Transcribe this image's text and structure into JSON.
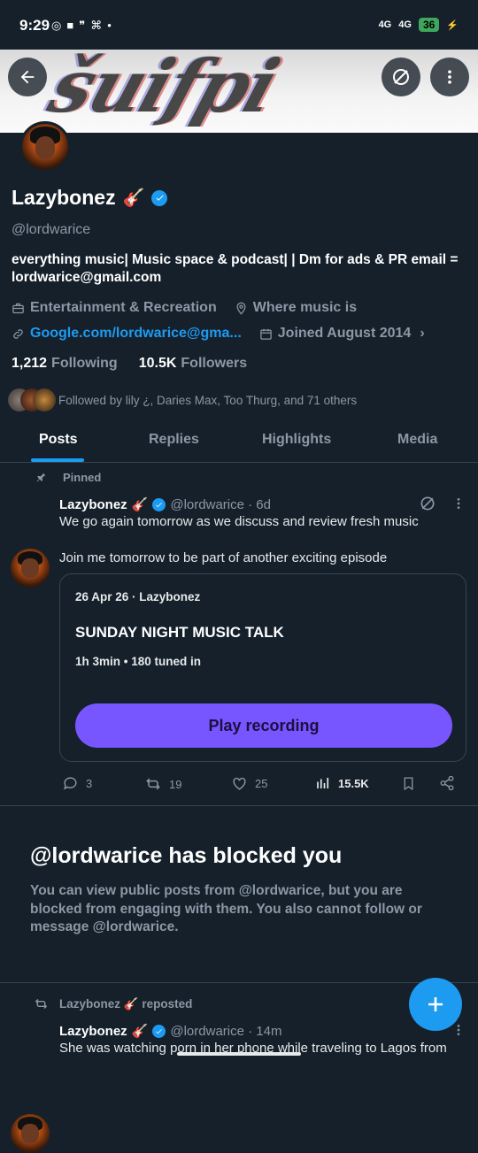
{
  "status_bar": {
    "time": "9:29",
    "signal1": "4G",
    "signal2": "4G",
    "battery": "36"
  },
  "profile": {
    "name": "Lazybonez",
    "name_emoji": "🎸",
    "handle": "@lordwarice",
    "bio": "everything music| Music space & podcast| | Dm for ads & PR  email = lordwarice@gmail.com",
    "category": "Entertainment & Recreation",
    "location": "Where music is",
    "link": "Google.com/lordwarice@gma...",
    "joined": "Joined August 2014",
    "following_count": "1,212",
    "following_label": "Following",
    "followers_count": "10.5K",
    "followers_label": "Followers",
    "followed_by": "Followed by lily ¿, Daries Max, Too Thurg, and 71 others"
  },
  "tabs": [
    "Posts",
    "Replies",
    "Highlights",
    "Media"
  ],
  "pinned_post": {
    "pinned_label": "Pinned",
    "author": "Lazybonez",
    "handle_time": "@lordwarice · 6d",
    "text1": "We go again tomorrow as we discuss and review fresh music",
    "text2": "Join me tomorrow to be part of another exciting episode",
    "card": {
      "meta": "26 Apr 26 · Lazybonez",
      "title": "SUNDAY NIGHT MUSIC TALK",
      "stats": "1h 3min • 180 tuned in",
      "button": "Play recording"
    },
    "actions": {
      "replies": "3",
      "reposts": "19",
      "likes": "25",
      "views": "15.5K"
    }
  },
  "blocked": {
    "title": "@lordwarice has blocked you",
    "message": "You can view public posts from @lordwarice, but you are blocked from engaging with them. You also cannot follow or message @lordwarice."
  },
  "repost": {
    "label": "Lazybonez 🎸 reposted",
    "author": "Lazybonez",
    "handle_time": "@lordwarice · 14m",
    "text": "She was watching porn in her phone while traveling to Lagos from"
  },
  "colors": {
    "accent": "#1d9bf0",
    "play_button": "#7856ff",
    "background": "#15202b"
  }
}
